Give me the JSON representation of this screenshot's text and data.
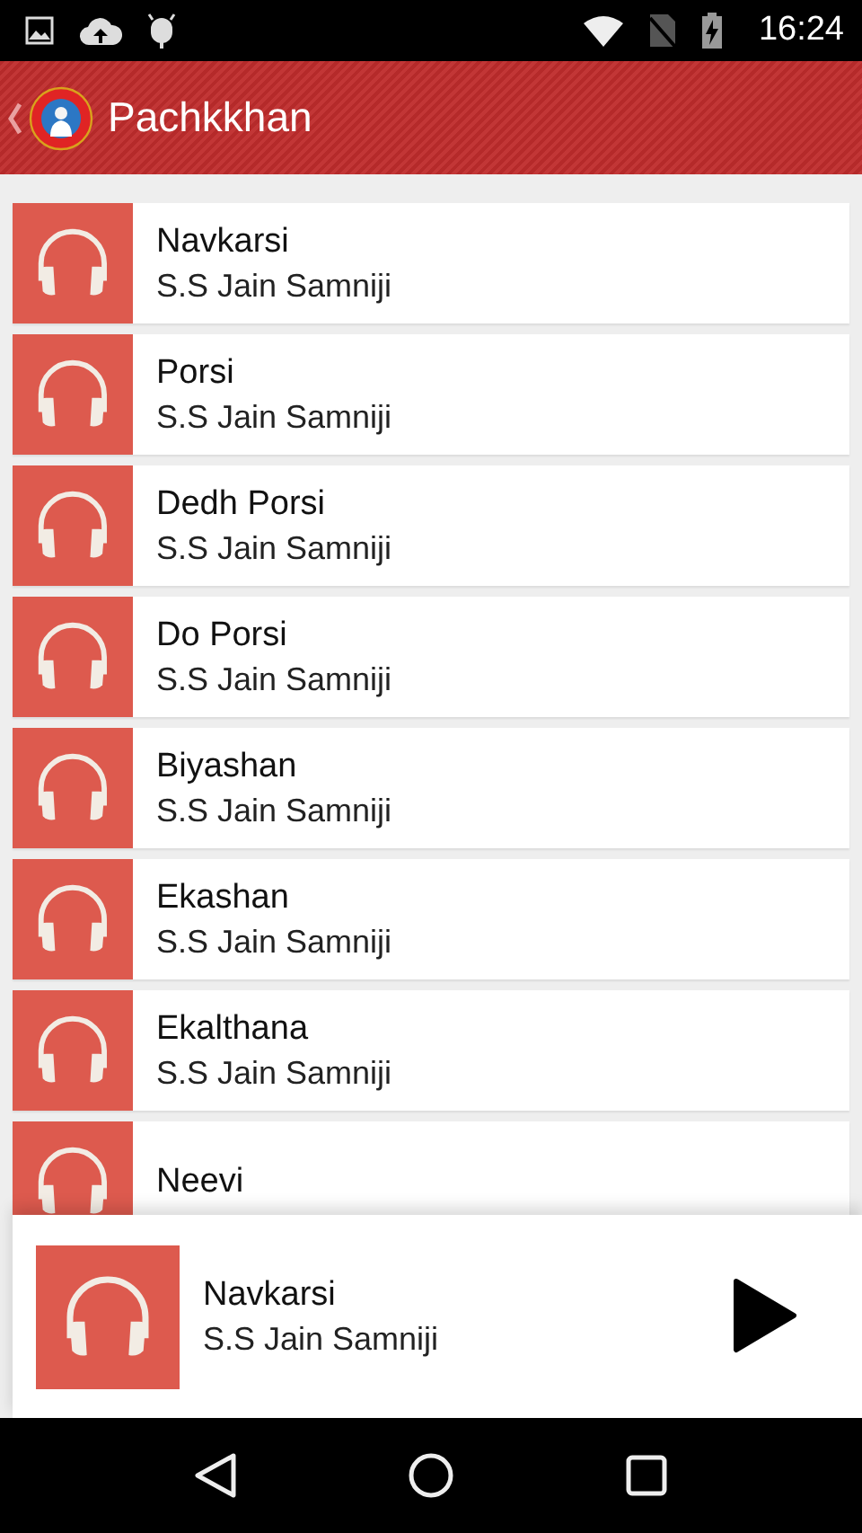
{
  "status_bar": {
    "time": "16:24"
  },
  "app_bar": {
    "title": "Pachkkhan"
  },
  "tracks": [
    {
      "title": "Navkarsi",
      "artist": "S.S Jain Samniji"
    },
    {
      "title": "Porsi",
      "artist": "S.S Jain Samniji"
    },
    {
      "title": "Dedh Porsi",
      "artist": "S.S Jain Samniji"
    },
    {
      "title": "Do Porsi",
      "artist": "S.S Jain Samniji"
    },
    {
      "title": "Biyashan",
      "artist": "S.S Jain Samniji"
    },
    {
      "title": "Ekashan",
      "artist": "S.S Jain Samniji"
    },
    {
      "title": "Ekalthana",
      "artist": "S.S Jain Samniji"
    },
    {
      "title": "Neevi"
    }
  ],
  "player": {
    "title": "Navkarsi",
    "artist": "S.S Jain Samniji"
  }
}
